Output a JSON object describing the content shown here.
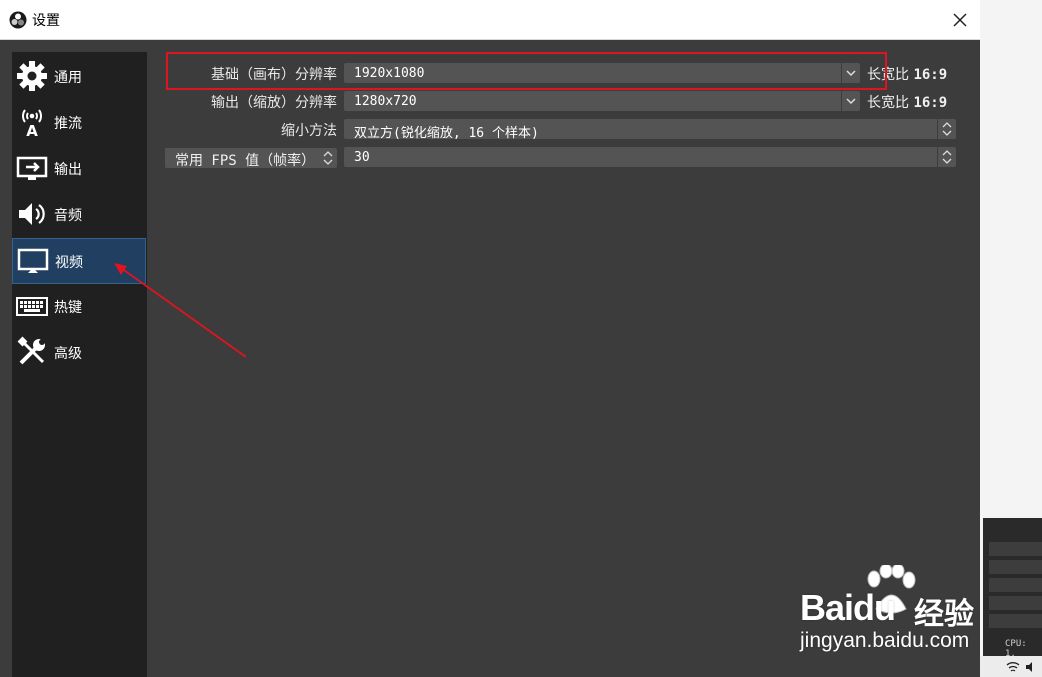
{
  "window": {
    "title": "设置"
  },
  "sidebar": {
    "items": [
      {
        "label": "通用",
        "icon": "gear-icon"
      },
      {
        "label": "推流",
        "icon": "antenna-icon"
      },
      {
        "label": "输出",
        "icon": "output-monitor-icon"
      },
      {
        "label": "音频",
        "icon": "speaker-icon"
      },
      {
        "label": "视频",
        "icon": "monitor-icon",
        "active": true
      },
      {
        "label": "热键",
        "icon": "keyboard-icon"
      },
      {
        "label": "高级",
        "icon": "tools-icon"
      }
    ]
  },
  "video": {
    "base_resolution": {
      "label": "基础（画布）分辨率",
      "value": "1920x1080",
      "aspect_label": "长宽比",
      "aspect_value": "16:9"
    },
    "output_resolution": {
      "label": "输出（缩放）分辨率",
      "value": "1280x720",
      "aspect_label": "长宽比",
      "aspect_value": "16:9"
    },
    "downscale_filter": {
      "label": "缩小方法",
      "value": "双立方(锐化缩放, 16 个样本)"
    },
    "fps": {
      "label": "常用 FPS 值（帧率）",
      "value": "30"
    }
  },
  "background": {
    "cpu_text": "CPU: 1."
  },
  "watermark": {
    "brand": "Baidu",
    "product": "经验",
    "url": "jingyan.baidu.com"
  },
  "colors": {
    "highlight": "#e0141e",
    "active_item": "#203f61"
  }
}
